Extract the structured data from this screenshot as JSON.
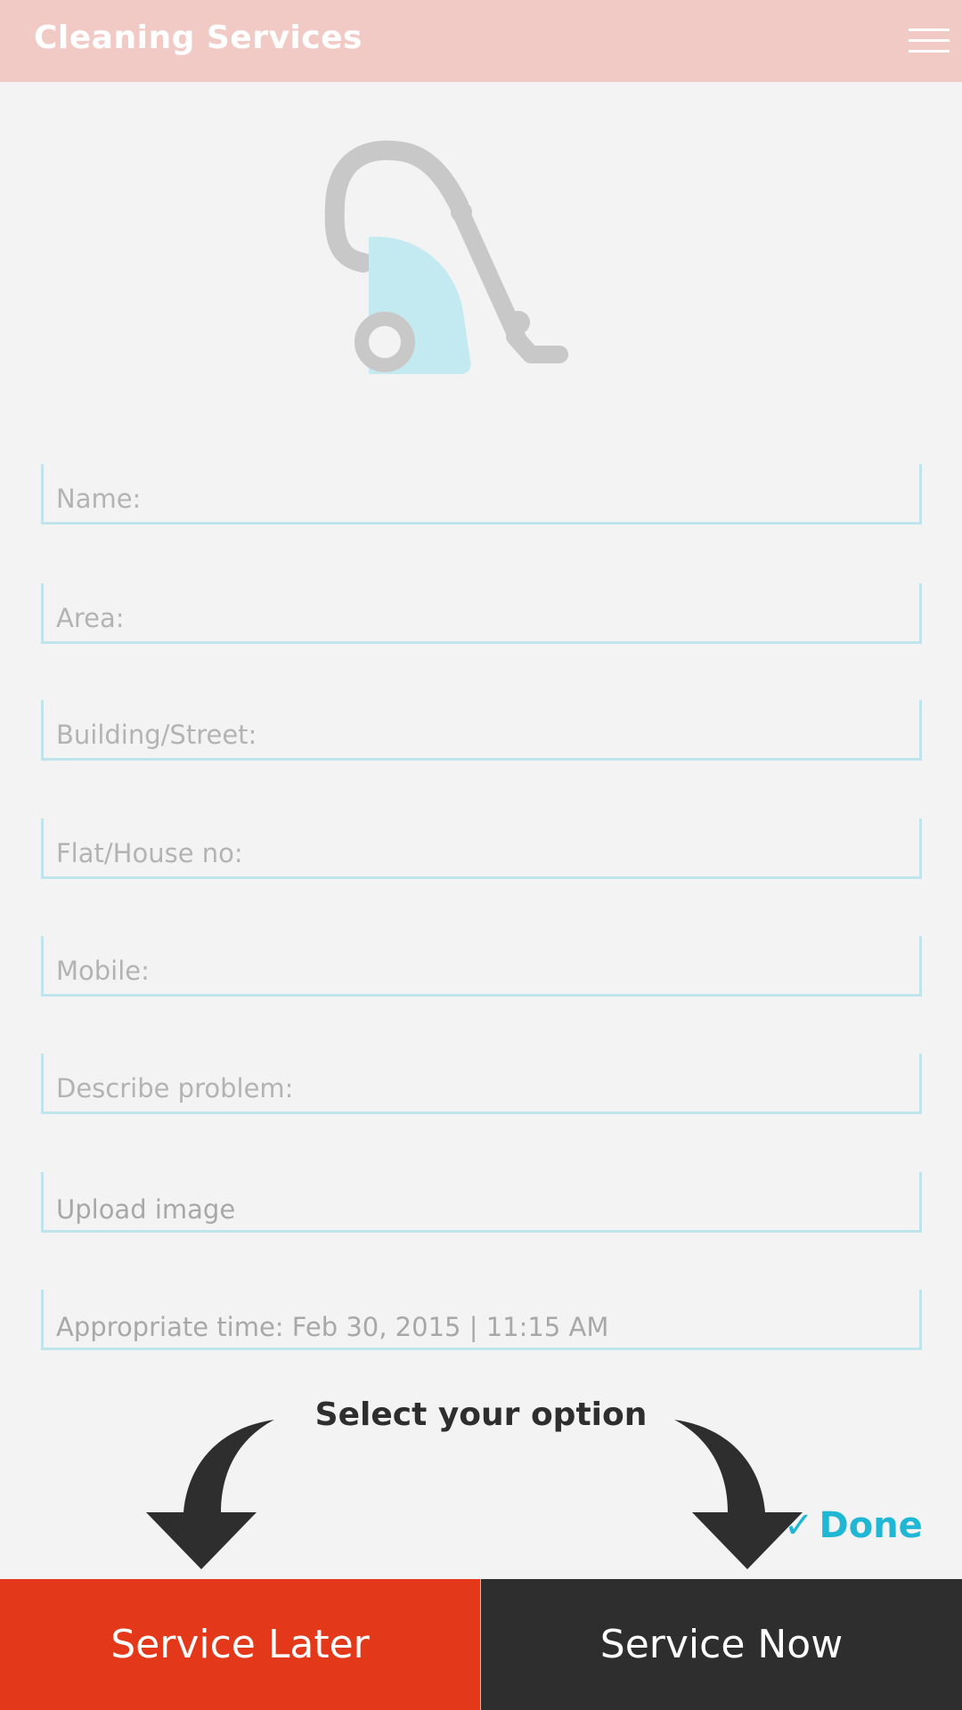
{
  "header": {
    "title": "Cleaning Services",
    "menu_icon": "hamburger-menu-icon"
  },
  "logo": {
    "icon": "vacuum-cleaner-icon",
    "colors": {
      "body": "#c3c3c3",
      "accent": "#c2eaf0"
    }
  },
  "form": {
    "name_placeholder": "Name:",
    "area_placeholder": "Area:",
    "building_placeholder": "Building/Street:",
    "flat_placeholder": "Flat/House no:",
    "mobile_placeholder": "Mobile:",
    "problem_placeholder": "Describe problem:",
    "upload_label": "Upload image",
    "time_label": "Appropriate time:",
    "time_value": "Feb 30, 2015  |  11:15 AM"
  },
  "options": {
    "title": "Select your option",
    "done_label": "Done",
    "done_icon": "checkmark-icon"
  },
  "buttons": {
    "later_label": "Service Later",
    "now_label": "Service Now"
  },
  "colors": {
    "header_bg": "#f1cac6",
    "field_border": "#bfe4ec",
    "later_bg": "#e3391a",
    "now_bg": "#2e2e2e",
    "done": "#1fb7d4"
  }
}
